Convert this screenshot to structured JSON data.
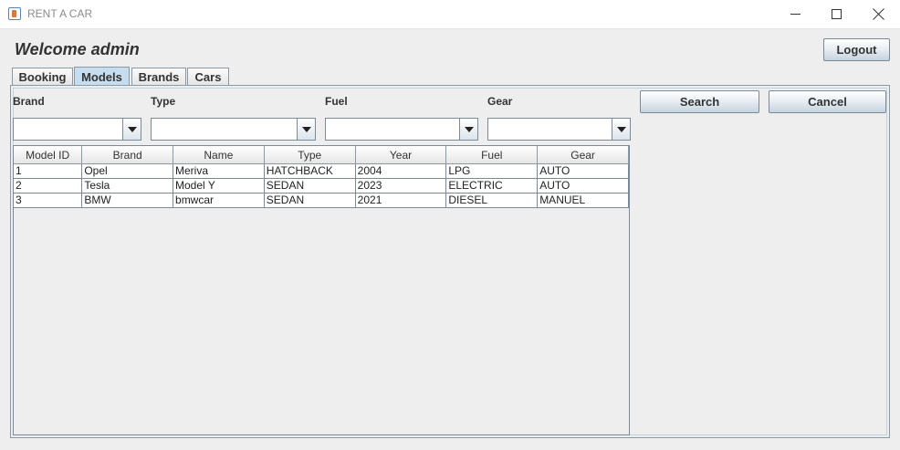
{
  "window": {
    "title": "RENT A CAR"
  },
  "header": {
    "welcome": "Welcome admin",
    "logout_label": "Logout"
  },
  "tabs": [
    {
      "label": "Booking",
      "selected": false
    },
    {
      "label": "Models",
      "selected": true
    },
    {
      "label": "Brands",
      "selected": false
    },
    {
      "label": "Cars",
      "selected": false
    }
  ],
  "filters": {
    "brand": {
      "label": "Brand",
      "value": ""
    },
    "type": {
      "label": "Type",
      "value": ""
    },
    "fuel": {
      "label": "Fuel",
      "value": ""
    },
    "gear": {
      "label": "Gear",
      "value": ""
    }
  },
  "actions": {
    "search_label": "Search",
    "cancel_label": "Cancel"
  },
  "table": {
    "columns": [
      "Model ID",
      "Brand",
      "Name",
      "Type",
      "Year",
      "Fuel",
      "Gear"
    ],
    "rows": [
      [
        "1",
        "Opel",
        "Meriva",
        "HATCHBACK",
        "2004",
        "LPG",
        "AUTO"
      ],
      [
        "2",
        "Tesla",
        "Model Y",
        "SEDAN",
        "2023",
        "ELECTRIC",
        "AUTO"
      ],
      [
        "3",
        "BMW",
        "bmwcar",
        "SEDAN",
        "2021",
        "DIESEL",
        "MANUEL"
      ]
    ]
  },
  "colors": {
    "selected_tab": "#c6dcef",
    "background": "#eeeeee"
  }
}
